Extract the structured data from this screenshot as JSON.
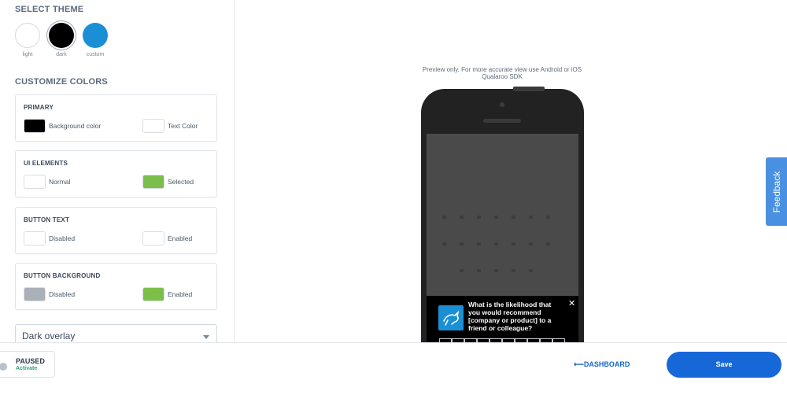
{
  "theme": {
    "title": "SELECT THEME",
    "options": [
      {
        "label": "light"
      },
      {
        "label": "dark"
      },
      {
        "label": "custom"
      }
    ],
    "selected": "dark"
  },
  "customize": {
    "title": "CUSTOMIZE COLORS",
    "cards": [
      {
        "title": "PRIMARY",
        "left": {
          "label": "Background color",
          "color": "#000000"
        },
        "right": {
          "label": "Text Color",
          "color": "#ffffff"
        }
      },
      {
        "title": "UI ELEMENTS",
        "left": {
          "label": "Normal",
          "color": "#ffffff"
        },
        "right": {
          "label": "Selected",
          "color": "#7bbf4a"
        }
      },
      {
        "title": "BUTTON TEXT",
        "left": {
          "label": "Disabled",
          "color": "#ffffff"
        },
        "right": {
          "label": "Enabled",
          "color": "#ffffff"
        }
      },
      {
        "title": "BUTTON BACKGROUND",
        "left": {
          "label": "Disabled",
          "color": "#a9b0b8"
        },
        "right": {
          "label": "Enabled",
          "color": "#7bbf4a"
        }
      }
    ]
  },
  "overlay": {
    "selected": "Dark overlay"
  },
  "preview": {
    "note": "Preview only. For more accurate view use Android or iOS Qualaroo SDK",
    "survey_question": "What is the likelihood that you would recommend [company or product] to a friend or colleague?",
    "close_glyph": "✕"
  },
  "feedback_tab": {
    "label": "Feedback"
  },
  "footer": {
    "status_title": "PAUSED",
    "status_action": "Activate",
    "dashboard_link": "⟵DASHBOARD",
    "save_label": "Save"
  },
  "colors": {
    "accent": "#1667d8",
    "custom_theme": "#1b8fd6",
    "active_green": "#2aa37a"
  }
}
